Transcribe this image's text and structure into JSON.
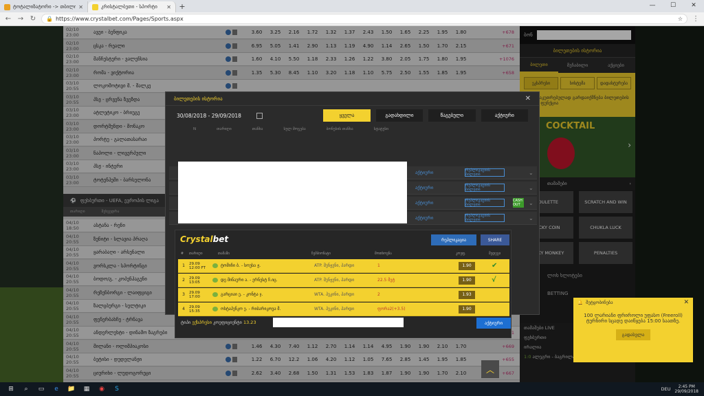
{
  "browser": {
    "tabs": [
      {
        "title": "ტოტალიზატორი -> თბილი...",
        "favicon_color": "#e9a020"
      },
      {
        "title": "კრისტალბეთი - სპორტი",
        "favicon_color": "#f3d12f"
      }
    ],
    "new_tab": "+",
    "url": "https://www.crystalbet.com/Pages/Sports.aspx",
    "window_controls": {
      "minimize": "—",
      "maximize": "☐",
      "close": "✕"
    }
  },
  "matches": [
    {
      "time": "02/10 23:00",
      "name": "ავეი - ბენფიკა",
      "odds": [
        "3.60",
        "3.25",
        "2.16",
        "1.72",
        "1.32",
        "1.37",
        "2.43",
        "1.50",
        "1.65",
        "2.25",
        "1.95",
        "1.80"
      ],
      "more": "+678"
    },
    {
      "time": "02/10 23:00",
      "name": "ცსკა - რეალი",
      "odds": [
        "6.95",
        "5.05",
        "1.41",
        "2.90",
        "1.13",
        "1.19",
        "4.90",
        "1.14",
        "2.65",
        "1.50",
        "1.70",
        "2.15"
      ],
      "more": "+671"
    },
    {
      "time": "02/10 23:00",
      "name": "მანჩესტერი - ვალენსია",
      "odds": [
        "1.60",
        "4.10",
        "5.50",
        "1.18",
        "2.33",
        "1.26",
        "1.22",
        "3.80",
        "2.05",
        "1.75",
        "1.80",
        "1.95"
      ],
      "more": "+1076"
    },
    {
      "time": "02/10 23:00",
      "name": "რომა - ვიქტორია",
      "odds": [
        "1.35",
        "5.30",
        "8.45",
        "1.10",
        "3.20",
        "1.18",
        "1.10",
        "5.75",
        "2.50",
        "1.55",
        "1.85",
        "1.95"
      ],
      "more": "+658"
    },
    {
      "time": "03/10 20:55",
      "name": "ლოკომოტივი მ. - შალკე",
      "odds": [],
      "more": ""
    },
    {
      "time": "03/10 20:55",
      "name": "პსვ - ცრვენა ზვეზდა",
      "odds": [],
      "more": ""
    },
    {
      "time": "03/10 23:00",
      "name": "ატლეტიკო - ბრიუგე",
      "odds": [],
      "more": ""
    },
    {
      "time": "03/10 23:00",
      "name": "დორტმუნდი - მონაკო",
      "odds": [],
      "more": ""
    },
    {
      "time": "03/10 23:00",
      "name": "პორტუ - გალათასარაი",
      "odds": [],
      "more": ""
    },
    {
      "time": "03/10 23:00",
      "name": "ნაპოლი - ლივერპული",
      "odds": [],
      "more": ""
    },
    {
      "time": "03/10 23:00",
      "name": "პსჟ - ინტერი",
      "odds": [],
      "more": ""
    },
    {
      "time": "03/10 23:00",
      "name": "ტოტენჰემი - ბარსელონა",
      "odds": [],
      "more": ""
    }
  ],
  "section": {
    "title": "ფეხბურთი - UEFA, ევროპის ლიგა",
    "icon": "soccer-ball-icon",
    "col_time": "თარიღი",
    "col_match": "შეხვედრა"
  },
  "matches2": [
    {
      "time": "04/10 18:50",
      "name": "ასტანა - რენი",
      "odds": [],
      "more": ""
    },
    {
      "time": "04/10 20:55",
      "name": "ზენიტი - სლავია პრაღა",
      "odds": [],
      "more": ""
    },
    {
      "time": "04/10 20:55",
      "name": "ყარაბაღი - არსენალი",
      "odds": [],
      "more": ""
    },
    {
      "time": "04/10 20:55",
      "name": "ვორსკლა - სპორტინგი",
      "odds": [],
      "more": ""
    },
    {
      "time": "04/10 20:55",
      "name": "ბოდო/გ. - კოპენჰაგენი",
      "odds": [],
      "more": ""
    },
    {
      "time": "04/10 20:55",
      "name": "რეზენბორგი - ლაიფციგი",
      "odds": [],
      "more": ""
    },
    {
      "time": "04/10 20:55",
      "name": "ზალცბურგი - სელტიკი",
      "odds": [],
      "more": ""
    },
    {
      "time": "04/10 20:55",
      "name": "ფენერბახჩე - ტრნავა",
      "odds": [],
      "more": ""
    },
    {
      "time": "04/10 20:55",
      "name": "ანდერლეხტი - დინამო ზაგრები",
      "odds": [
        "2.04",
        "3.45",
        "3.70",
        "1.31",
        "1.79",
        "1.34",
        "1.46",
        "2.55",
        "1.95",
        "1.85",
        "1.70",
        "2.10"
      ],
      "more": "+671"
    },
    {
      "time": "04/10 20:55",
      "name": "მილანი - ოლიმპიაკოსი",
      "odds": [
        "1.46",
        "4.30",
        "7.40",
        "1.12",
        "2.70",
        "1.14",
        "1.14",
        "4.95",
        "1.90",
        "1.90",
        "2.10",
        "1.70"
      ],
      "more": "+669"
    },
    {
      "time": "04/10 20:55",
      "name": "ბეტისი - დუდელანჟი",
      "odds": [
        "1.22",
        "6.70",
        "12.2",
        "1.06",
        "4.20",
        "1.12",
        "1.05",
        "7.65",
        "2.85",
        "1.45",
        "1.95",
        "1.85"
      ],
      "more": "+655"
    },
    {
      "time": "04/10 20:55",
      "name": "ციურიხი - ლუდოგორეცი",
      "odds": [
        "2.62",
        "3.40",
        "2.68",
        "1.50",
        "1.31",
        "1.53",
        "1.83",
        "1.87",
        "1.90",
        "1.90",
        "1.70",
        "2.10"
      ],
      "more": "+667"
    }
  ],
  "sidebar": {
    "login_label": "ბონ",
    "bet_history_header": "ბილეთების ისტორია",
    "tabs": [
      "ბილეთი",
      "მეჩაბილი",
      "აქციები"
    ],
    "options": [
      "ეკსპრესი",
      "სისტემა",
      "დადასტურება"
    ],
    "hint": "ეს განსაკუთრებულად გარდაიქმნება ბილეთების სრული ფუნქცია",
    "promo_title": "COCKTAIL",
    "games_header": "თამაშები",
    "tiles": [
      "ROULETTE",
      "SCRATCH AND WIN",
      "LUCKY COIN",
      "CHUKLA LUCK",
      "LUCKY MONKEY",
      "PENALTIES"
    ],
    "link1": "ლოხ ხლოტები",
    "link2": "BETTING",
    "live_header": "თამაშები LIVE",
    "live_sport": "ფეხბურთი",
    "live_team": "ირალია",
    "live_score": "1:0",
    "live_match": "ალეგრი - ბაგრილა"
  },
  "modal": {
    "title": "ბილეთების ისტორია",
    "close": "✕",
    "date_range": "30/08/2018 - 29/09/2018",
    "filters": [
      "ყველა",
      "გადახდილი",
      "წაგებული",
      "აქტიური"
    ],
    "active_filter": 0,
    "headers": [
      "N",
      "თარიღი",
      "თანხა",
      "სულ მოგება",
      "ბონუსის თანხა",
      "სტატუსი"
    ],
    "history_rows": [
      {
        "status": "აქტიური",
        "action": "რეპლიკაციის ბილეთი",
        "cashout": ""
      },
      {
        "status": "აქტიური",
        "action": "რეპლიკაციის ბილეთი",
        "cashout": ""
      },
      {
        "status": "აქტიური",
        "action": "რეპლიკაციის ბილეთი",
        "cashout": "CASH OUT"
      },
      {
        "status": "აქტიური",
        "action": "რეპლიკაციის ბილეთი",
        "cashout": ""
      }
    ],
    "slip": {
      "brand_a": "Crystal",
      "brand_b": "bet",
      "replicate_btn": "რეპლიკაცია",
      "share_btn": "SHARE",
      "headers": [
        "#",
        "თარიღი",
        "თამაში",
        "ჩემპიონატი",
        "მოთხოვნა",
        "კოეფ.",
        "შედეგი"
      ],
      "rows": [
        {
          "n": "1",
          "date": "29.09",
          "time": "12:00 FT",
          "match": "ტომიჩი ბ. - სოუსა ჟ.",
          "tournament": "ATP. შენჟენი, პარდი",
          "pick": "1",
          "odd": "1.90",
          "result": "✔"
        },
        {
          "n": "2",
          "date": "29.09",
          "time": "13:05",
          "match": "დე მინაური ა. - ერნესტ ჩ.იც.",
          "tournament": "ATP. შენჟენი, პარდი",
          "pick": "22.5 მეტ",
          "odd": "1.90",
          "result": "√"
        },
        {
          "n": "3",
          "date": "29.09",
          "time": "17:00",
          "match": "გარციაი ე. - კონტა ჯ.",
          "tournament": "WTA. პეკინი, პარდი",
          "pick": "2",
          "odd": "1.93",
          "result": ""
        },
        {
          "n": "4",
          "date": "29.09",
          "time": "15:35",
          "match": "ოსტაპენკო ე. - რიბარიკოვა მ.",
          "tournament": "WTA. პეკინი, პარდი",
          "pick": "ფორა2(+3.5)",
          "odd": "1.90",
          "result": ""
        }
      ],
      "footer_type_label": "ტიპი",
      "footer_type": "ექსპრესი",
      "footer_coef_label": "კოეფიციენტი",
      "footer_coef": "13.23",
      "active_btn": "აქტიური"
    }
  },
  "notification": {
    "title": "შეტყობინება",
    "text": "100 ლარიანი ფრიროლი უფასო (Freeroll) ტურნირი სცადე დაიწყება 15:00 საათზე.",
    "button": "გადასვლა",
    "close": "✕"
  },
  "taskbar": {
    "lang": "DEU",
    "time": "2:45 PM",
    "date": "29/09/2018",
    "icons": [
      "windows-icon",
      "search-icon",
      "taskview-icon",
      "edge-icon",
      "explorer-icon",
      "folder-icon",
      "calculator-icon",
      "chrome-icon",
      "skype-icon",
      "paint-icon"
    ]
  },
  "colors": {
    "accent": "#f3d12f",
    "link": "#4a90d6",
    "dark": "#2b2b2b"
  }
}
